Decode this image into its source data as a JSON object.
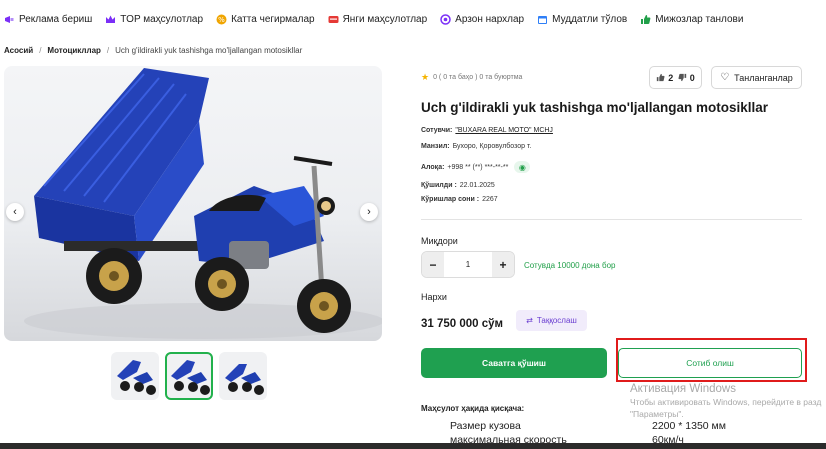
{
  "nav": [
    {
      "label": "Реклама бериш",
      "icon": "megaphone-icon",
      "color": "#7b2ff7"
    },
    {
      "label": "TOP маҳсулотлар",
      "icon": "crown-icon",
      "color": "#7b2ff7"
    },
    {
      "label": "Катта чегирмалар",
      "icon": "discount-icon",
      "color": "#f0a500"
    },
    {
      "label": "Янги маҳсулотлар",
      "icon": "new-badge-icon",
      "color": "#e53935"
    },
    {
      "label": "Арзон нархлар",
      "icon": "coin-icon",
      "color": "#7b2ff7"
    },
    {
      "label": "Муддатли тўлов",
      "icon": "calendar-icon",
      "color": "#2f7ff7"
    },
    {
      "label": "Мижозлар танлови",
      "icon": "like-icon",
      "color": "#22a04a"
    }
  ],
  "breadcrumb": {
    "home": "Асосий",
    "category": "Мотоцикллар",
    "current": "Uch g'ildirakli yuk tashishga mo'ljallangan motosikllar"
  },
  "product": {
    "rating_text": "0 ( 0 та баҳо ) 0 та буюртма",
    "likes": "2",
    "dislikes": "0",
    "favorite_label": "Танланганлар",
    "title": "Uch g'ildirakli yuk tashishga mo'ljallangan motosikllar",
    "seller_label": "Сотувчи:",
    "seller_name": "\"BUXARA REAL MOTO\" MCHJ",
    "address_label": "Манзил:",
    "address": "Бухоро, Қоровулбозор т.",
    "phone_label": "Алоқа:",
    "phone": "+998 ** (**) ***-**-**",
    "added_label": "Қўшилди :",
    "added": "22.01.2025",
    "views_label": "Кўришлар сони :",
    "views": "2267",
    "quantity_label": "Миқдори",
    "quantity": "1",
    "stock_text": "Сотувда 10000 дона бор",
    "price_label": "Нархи",
    "price": "31 750 000 сўм",
    "compare_label": "Таққослаш",
    "cart_label": "Саватга қўшиш",
    "buy_label": "Сотиб олиш",
    "brief_title": "Маҳсулот ҳақида қисқача:",
    "specs": [
      {
        "name": "Размер кузова",
        "value": "2200 * 1350 мм"
      },
      {
        "name": "максимальная скорость",
        "value": "60км/ч"
      }
    ]
  },
  "gallery": {
    "thumb_count": 3,
    "active_thumb": 1,
    "vehicle_color": "#1f3fb0"
  },
  "watermark": {
    "line1": "Активация Windows",
    "line2": "Чтобы активировать Windows, перейдите в разд",
    "line3": "\"Параметры\"."
  }
}
